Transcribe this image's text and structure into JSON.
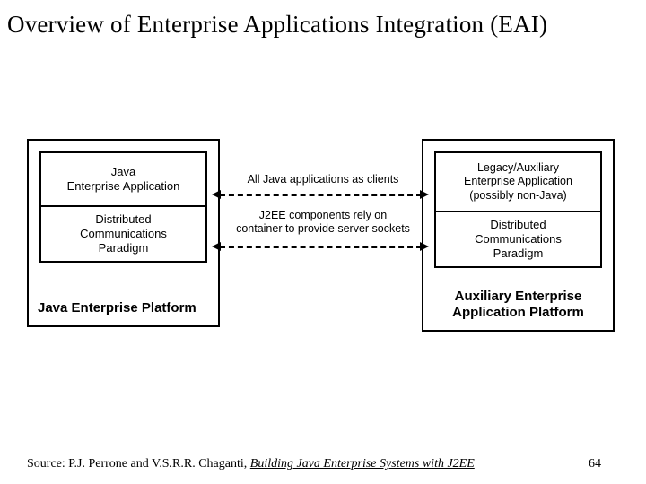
{
  "title": "Overview of Enterprise Applications Integration (EAI)",
  "left_platform": {
    "top_box": "Java\nEnterprise Application",
    "bottom_box": "Distributed\nCommunications\nParadigm",
    "label": "Java Enterprise Platform"
  },
  "right_platform": {
    "top_box": "Legacy/Auxiliary\nEnterprise Application\n(possibly non-Java)",
    "bottom_box": "Distributed\nCommunications\nParadigm",
    "label": "Auxiliary Enterprise\nApplication Platform"
  },
  "connections": {
    "top": "All Java applications as clients",
    "bottom": "J2EE components rely on\ncontainer to provide server sockets"
  },
  "footer": {
    "source_prefix": "Source: P.J. Perrone and V.S.R.R. Chaganti, ",
    "book": "Building Java Enterprise Systems with J2EE",
    "page": "64"
  }
}
